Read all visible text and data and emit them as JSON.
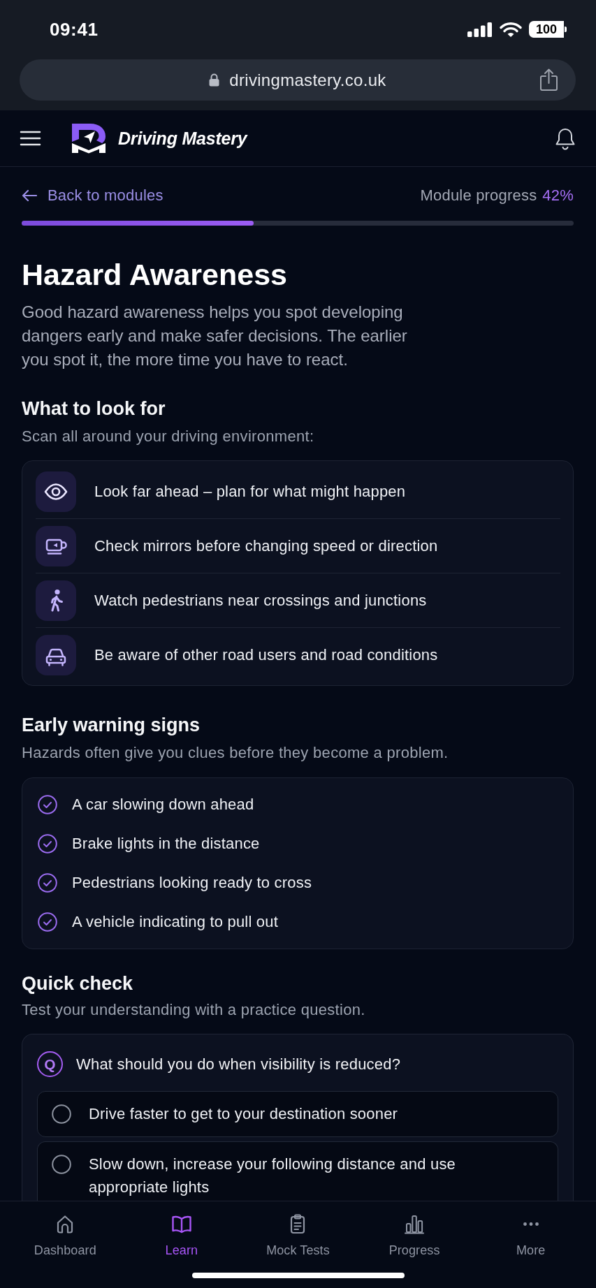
{
  "status_bar": {
    "time": "09:41",
    "battery": "100"
  },
  "browser": {
    "url": "drivingmastery.co.uk"
  },
  "header": {
    "brand": "Driving Mastery"
  },
  "module": {
    "back_link": "Back to modules",
    "progress_label": "Module progress",
    "progress_value": "42%",
    "level": 0.42
  },
  "lesson": {
    "title": "Hazard Awareness",
    "intro": "Good hazard awareness helps you spot developing dangers early and make safer decisions. The earlier you spot it, the more time you have to react."
  },
  "look_for": {
    "heading": "What to look for",
    "subtitle": "Scan all around your driving environment:",
    "items": [
      "Look far ahead – plan for what might happen",
      "Check mirrors before changing speed or direction",
      "Watch pedestrians near crossings and junctions",
      "Be aware of other road users and road conditions"
    ]
  },
  "warning_signs": {
    "heading": "Early warning signs",
    "subtitle": "Hazards often give you clues before they become a problem.",
    "items": [
      "A car slowing down ahead",
      "Brake lights in the distance",
      "Pedestrians looking ready to cross",
      "A vehicle indicating to pull out"
    ]
  },
  "quick_check": {
    "heading": "Quick check",
    "subtitle": "Test your understanding with a practice question.",
    "badge": "Q",
    "question": "What should you do when visibility is reduced?",
    "options": [
      {
        "text": "Drive faster to get to your destination sooner",
        "selected": false
      },
      {
        "text": "Slow down, increase your following distance and use appropriate lights",
        "selected": false
      }
    ]
  },
  "bottom_nav": {
    "tabs": [
      {
        "label": "Dashboard",
        "selected": false
      },
      {
        "label": "Learn",
        "selected": true
      },
      {
        "label": "Mock Tests",
        "selected": false
      },
      {
        "label": "Progress",
        "selected": false
      },
      {
        "label": "More",
        "selected": false
      }
    ]
  }
}
